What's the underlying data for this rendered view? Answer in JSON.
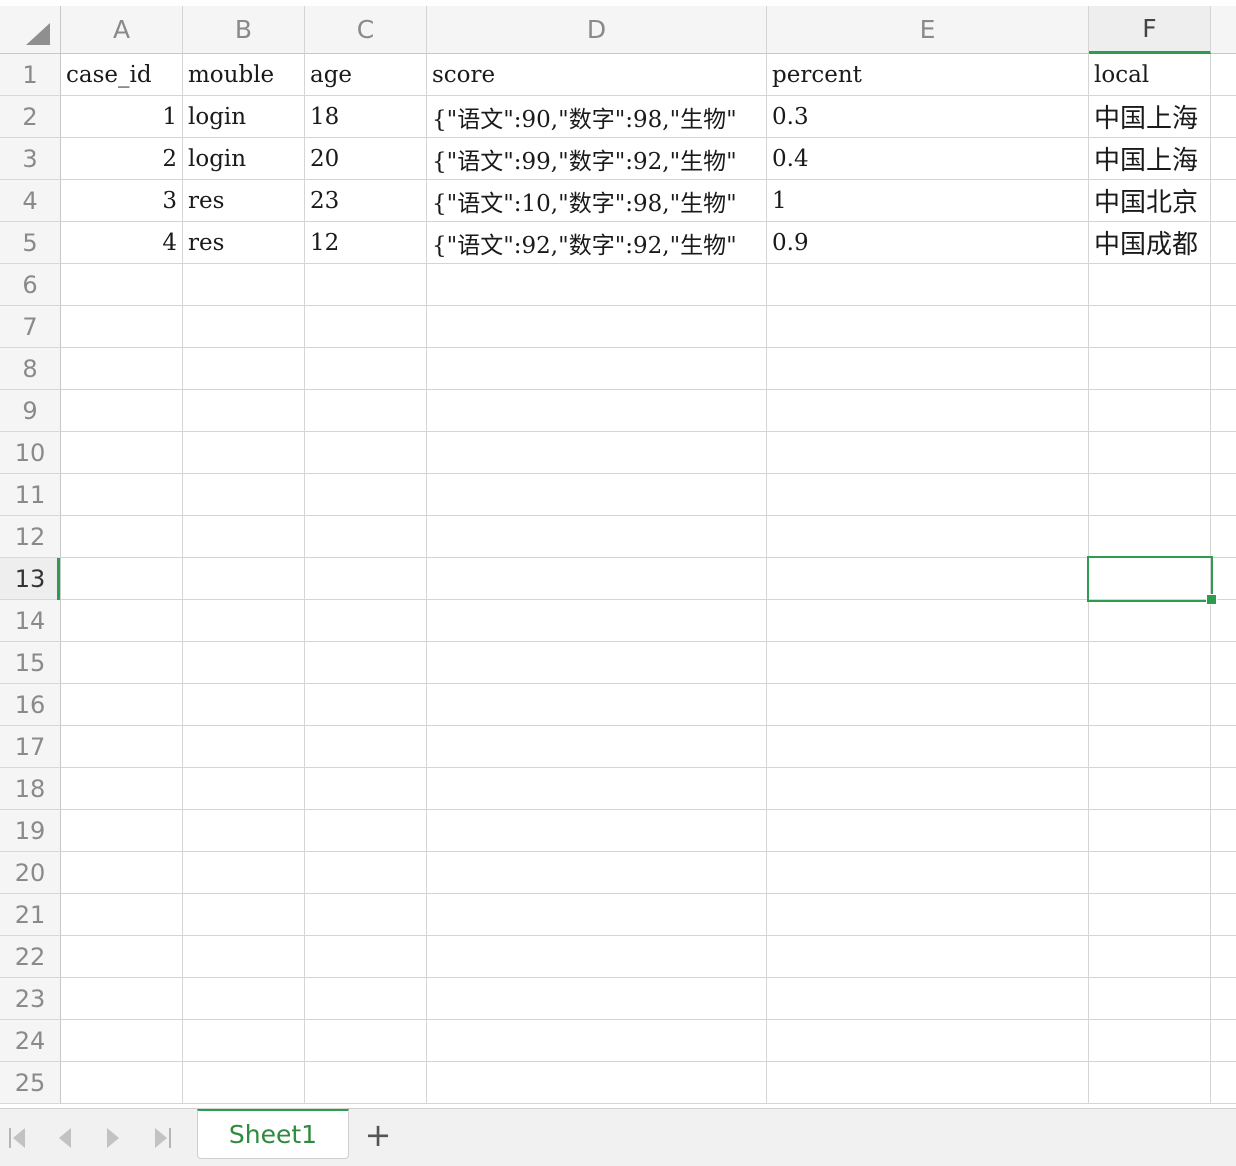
{
  "columns": [
    "A",
    "B",
    "C",
    "D",
    "E",
    "F"
  ],
  "rows": [
    "1",
    "2",
    "3",
    "4",
    "5",
    "6",
    "7",
    "8",
    "9",
    "10",
    "11",
    "12",
    "13",
    "14",
    "15",
    "16",
    "17",
    "18",
    "19",
    "20",
    "21",
    "22",
    "23",
    "24",
    "25"
  ],
  "active_cell": "F13",
  "cells": {
    "A1": "case_id",
    "B1": "mouble",
    "C1": "age",
    "D1": "score",
    "E1": "percent",
    "F1": "local",
    "A2": "1",
    "B2": "login",
    "C2": "18",
    "D2": "{\"语文\":90,\"数字\":98,\"生物\"",
    "E2": "0.3",
    "F2": "中国上海",
    "A3": "2",
    "B3": "login",
    "C3": "20",
    "D3": "{\"语文\":99,\"数字\":92,\"生物\"",
    "E3": "0.4",
    "F3": "中国上海",
    "A4": "3",
    "B4": "res",
    "C4": "23",
    "D4": "{\"语文\":10,\"数字\":98,\"生物\"",
    "E4": "1",
    "F4": "中国北京",
    "A5": "4",
    "B5": "res",
    "C5": "12",
    "D5": "{\"语文\":92,\"数字\":92,\"生物\"",
    "E5": "0.9",
    "F5": "中国成都"
  },
  "tabs": {
    "sheet1": "Sheet1",
    "add": "+"
  },
  "nav_icons": [
    "first-sheet-icon",
    "prev-sheet-icon",
    "next-sheet-icon",
    "last-sheet-icon"
  ],
  "colors": {
    "accent": "#2e9c4f"
  }
}
